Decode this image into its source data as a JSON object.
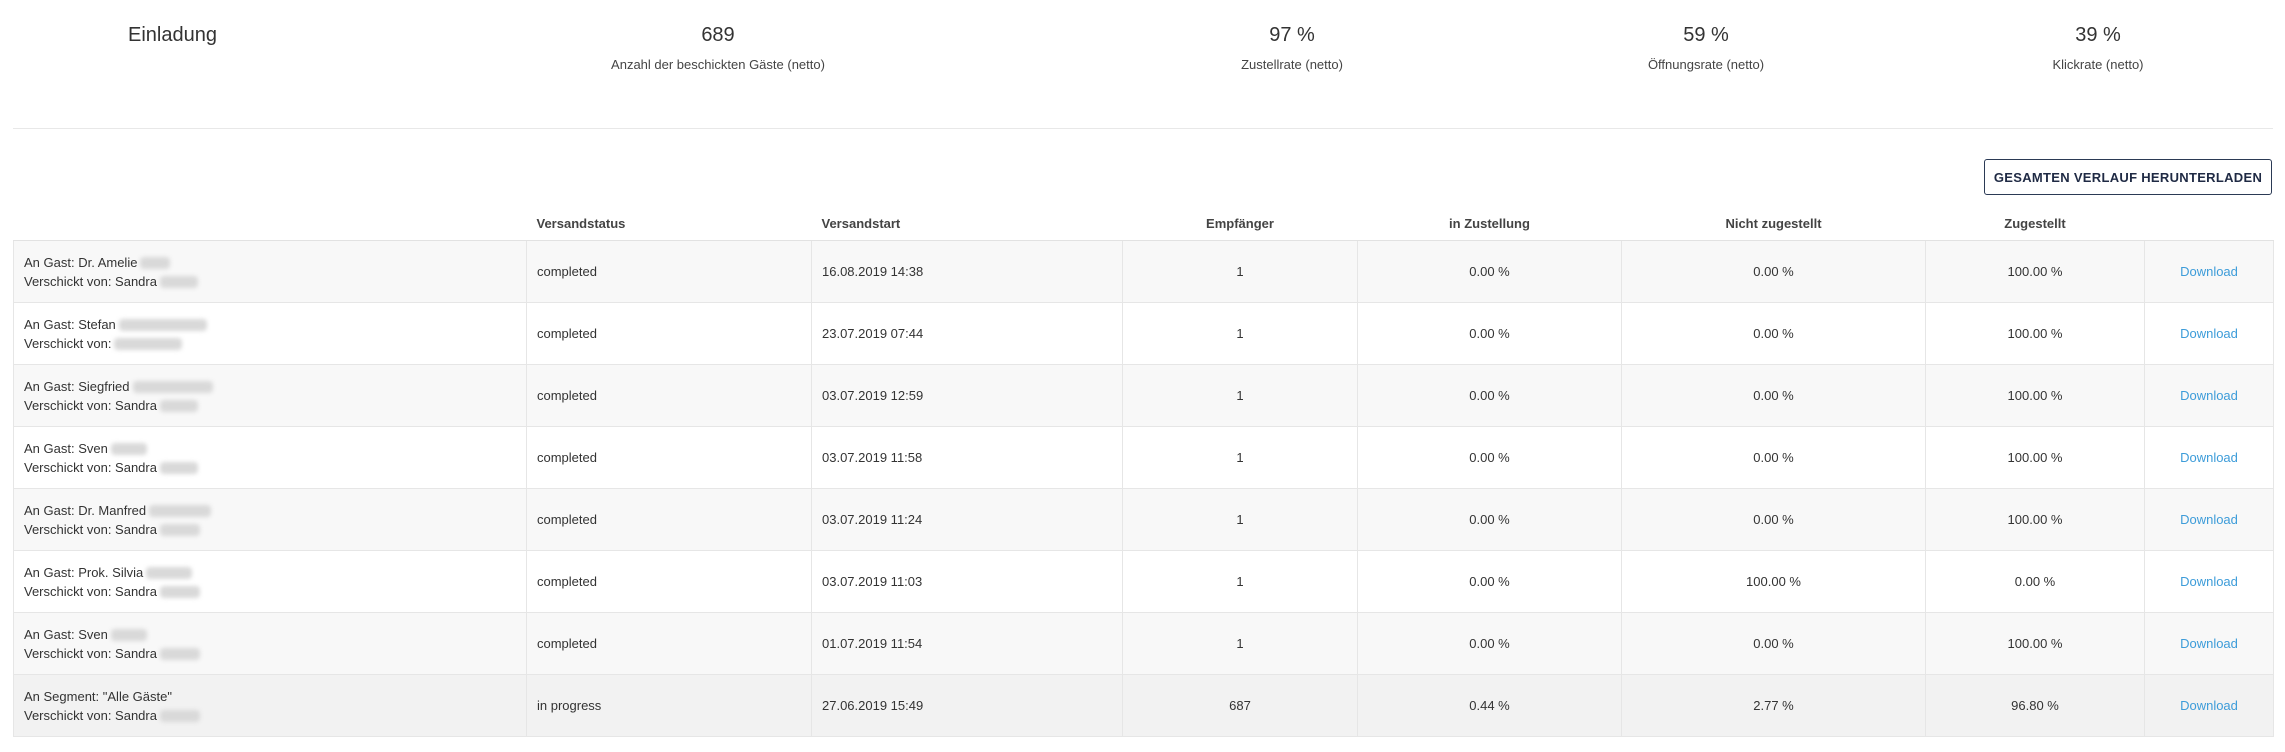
{
  "summary": {
    "title": "Einladung",
    "stats": [
      {
        "value": "689",
        "label": "Anzahl der beschickten Gäste (netto)"
      },
      {
        "value": "97 %",
        "label": "Zustellrate (netto)"
      },
      {
        "value": "59 %",
        "label": "Öffnungsrate (netto)"
      },
      {
        "value": "39 %",
        "label": "Klickrate (netto)"
      }
    ]
  },
  "download_all_label": "GESAMTEN VERLAUF HERUNTERLADEN",
  "table": {
    "columns": [
      "",
      "Versandstatus",
      "Versandstart",
      "Empfänger",
      "in Zustellung",
      "Nicht zugestellt",
      "Zugestellt",
      ""
    ],
    "rows": [
      {
        "to": "An Gast: Dr. Amelie",
        "from": "Verschickt von: Sandra",
        "status": "completed",
        "start": "16.08.2019 14:38",
        "recipients": "1",
        "in_delivery": "0.00 %",
        "not_delivered": "0.00 %",
        "delivered": "100.00 %",
        "action": "Download"
      },
      {
        "to": "An Gast: Stefan",
        "from": "Verschickt von:",
        "status": "completed",
        "start": "23.07.2019 07:44",
        "recipients": "1",
        "in_delivery": "0.00 %",
        "not_delivered": "0.00 %",
        "delivered": "100.00 %",
        "action": "Download"
      },
      {
        "to": "An Gast: Siegfried",
        "from": "Verschickt von: Sandra",
        "status": "completed",
        "start": "03.07.2019 12:59",
        "recipients": "1",
        "in_delivery": "0.00 %",
        "not_delivered": "0.00 %",
        "delivered": "100.00 %",
        "action": "Download"
      },
      {
        "to": "An Gast: Sven",
        "from": "Verschickt von: Sandra",
        "status": "completed",
        "start": "03.07.2019 11:58",
        "recipients": "1",
        "in_delivery": "0.00 %",
        "not_delivered": "0.00 %",
        "delivered": "100.00 %",
        "action": "Download"
      },
      {
        "to": "An Gast: Dr. Manfred",
        "from": "Verschickt von: Sandra",
        "status": "completed",
        "start": "03.07.2019 11:24",
        "recipients": "1",
        "in_delivery": "0.00 %",
        "not_delivered": "0.00 %",
        "delivered": "100.00 %",
        "action": "Download"
      },
      {
        "to": "An Gast: Prok. Silvia",
        "from": "Verschickt von: Sandra",
        "status": "completed",
        "start": "03.07.2019 11:03",
        "recipients": "1",
        "in_delivery": "0.00 %",
        "not_delivered": "100.00 %",
        "delivered": "0.00 %",
        "action": "Download"
      },
      {
        "to": "An Gast: Sven",
        "from": "Verschickt von: Sandra",
        "status": "completed",
        "start": "01.07.2019 11:54",
        "recipients": "1",
        "in_delivery": "0.00 %",
        "not_delivered": "0.00 %",
        "delivered": "100.00 %",
        "action": "Download"
      },
      {
        "to": "An Segment: \"Alle Gäste\"",
        "from": "Verschickt von: Sandra",
        "status": "in progress",
        "start": "27.06.2019 15:49",
        "recipients": "687",
        "in_delivery": "0.44 %",
        "not_delivered": "2.77 %",
        "delivered": "96.80 %",
        "action": "Download"
      }
    ]
  }
}
